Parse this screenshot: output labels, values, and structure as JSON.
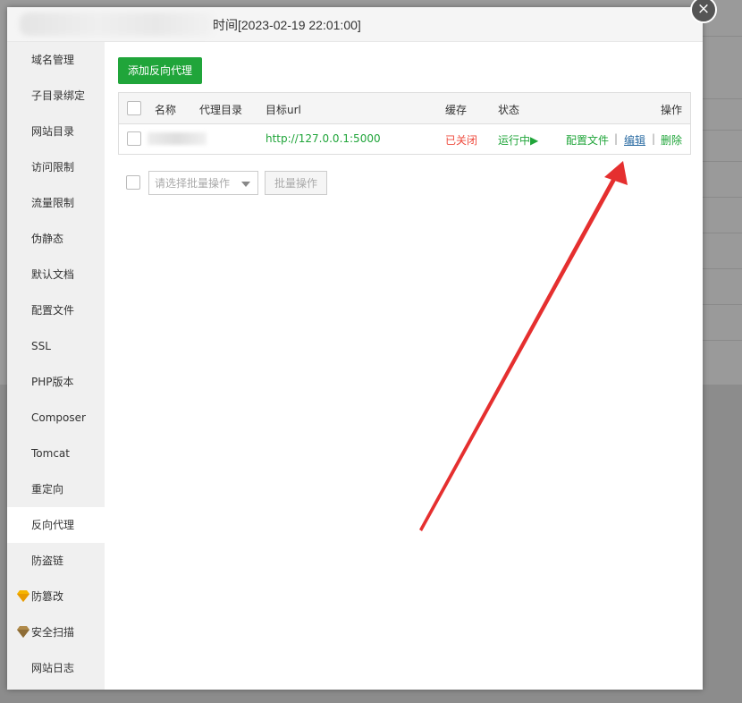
{
  "dialog": {
    "title": "时间[2023-02-19 22:01:00]",
    "close_glyph": "×"
  },
  "sidebar": {
    "items": [
      {
        "label": "域名管理"
      },
      {
        "label": "子目录绑定"
      },
      {
        "label": "网站目录"
      },
      {
        "label": "访问限制"
      },
      {
        "label": "流量限制"
      },
      {
        "label": "伪静态"
      },
      {
        "label": "默认文档"
      },
      {
        "label": "配置文件"
      },
      {
        "label": "SSL"
      },
      {
        "label": "PHP版本"
      },
      {
        "label": "Composer"
      },
      {
        "label": "Tomcat"
      },
      {
        "label": "重定向"
      },
      {
        "label": "反向代理",
        "active": true
      },
      {
        "label": "防盗链"
      },
      {
        "label": "防篡改",
        "icon": "gem-icon"
      },
      {
        "label": "安全扫描",
        "icon": "gem-icon"
      },
      {
        "label": "网站日志"
      }
    ]
  },
  "toolbar": {
    "add_label": "添加反向代理"
  },
  "table": {
    "headers": {
      "name": "名称",
      "proxy_dir": "代理目录",
      "target_url": "目标url",
      "cache": "缓存",
      "status": "状态",
      "actions": "操作"
    },
    "rows": [
      {
        "name": "",
        "proxy_dir": "",
        "target_url": "http://127.0.0.1:5000",
        "cache": "已关闭",
        "status": "运行中▶",
        "action_config": "配置文件",
        "action_edit": "编辑",
        "action_delete": "删除",
        "separator": "|"
      }
    ]
  },
  "batch": {
    "select_placeholder": "请选择批量操作",
    "button_label": "批量操作"
  },
  "colors": {
    "accent_green": "#20a53a",
    "status_red": "#ef4b3e",
    "link_blue": "#2b6ca3",
    "arrow_red": "#e52f2f"
  }
}
